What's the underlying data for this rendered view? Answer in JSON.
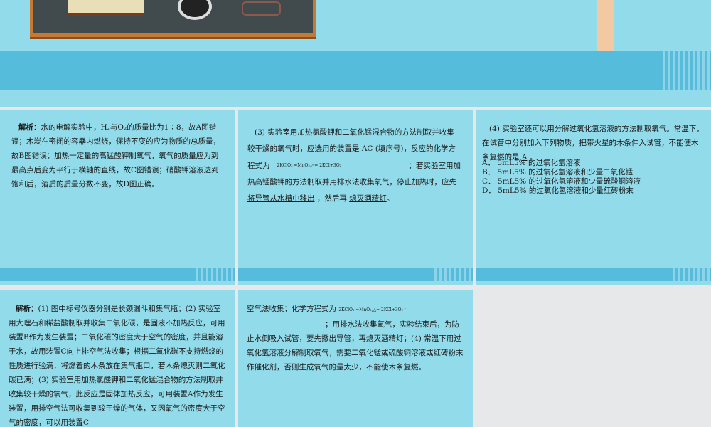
{
  "slide_a": {
    "label": "解析：",
    "text": "水的电解实验中，H₂与O₂的质量比为1∶8，故A图错误；木炭在密闭的容器内燃烧，保持不变的应为物质的总质量，故B图错误；加热一定量的高锰酸钾制氧气，氧气的质量应为到最高点后变为平行于横轴的直线，故C图错误；硝酸钾溶液达到饱和后，溶质的质量分数不变，故D图正确。"
  },
  "slide_b": {
    "p1": "(3) 实验室用加热氯酸钾和二氧化锰混合物的方法制取并收集较干燥的氧气时，应选用的装置是",
    "ans1": "AC",
    "p2": "(填序号)，反应的化学方程式为",
    "eq": "2KClO₃ =MnO₂,△= 2KCl+3O₂↑",
    "p3": "；若实验室用加热高锰酸钾的方法制取并用排水法收集氧气，停止加热时，应先",
    "ans2": "将导管从水槽中移出",
    "p4": "，然后再",
    "ans3": "熄灭酒精灯",
    "p5": "。"
  },
  "slide_c": {
    "p1": "(4) 实验室还可以用分解过氧化氢溶液的方法制取氧气。常温下，在试管中分别加入下列物质，把带火星的木条伸入试管，不能使木条复燃的是",
    "ans": "A",
    "p2": "。",
    "options": [
      "A． 5mL5% 的过氧化氢溶液",
      "B． 5mL5% 的过氧化氢溶液和少量二氧化锰",
      "C． 5mL5% 的过氧化氢溶液和少量硫酸铜溶液",
      "D． 5mL5% 的过氧化氢溶液和少量红砖粉末"
    ]
  },
  "slide_d": {
    "label": "解析：",
    "text": "(1) 图中标号仪器分别是长颈漏斗和集气瓶；(2) 实验室用大理石和稀盐酸制取并收集二氧化碳，是固液不加热反应，可用装置B作为发生装置；二氧化碳的密度大于空气的密度，并且能溶于水，故用装置C向上排空气法收集；根据二氧化碳不支持燃烧的性质进行验满，将燃着的木条放在集气瓶口，若木条熄灭则二氧化碳已满；(3) 实验室用加热氯酸钾和二氧化锰混合物的方法制取并收集较干燥的氧气，此反应是固体加热反应，可用装置A作为发生装置，用排空气法可收集到较干燥的气体，又因氧气的密度大于空气的密度，可以用装置C"
  },
  "slide_e": {
    "p1": "空气法收集；化学方程式为",
    "eq": "2KClO₃ =MnO₂,△= 2KCl+3O₂↑",
    "p2": "；用排水法收集氧气，实验结束后，为防止水倒吸入试管，要先撤出导管，再熄灭酒精灯；(4) 常温下用过氧化氢溶液分解制取氧气，需要二氧化锰或硫酸铜溶液或红砖粉末作催化剂，否则生成氧气的量太少，不能使木条复燃。"
  }
}
